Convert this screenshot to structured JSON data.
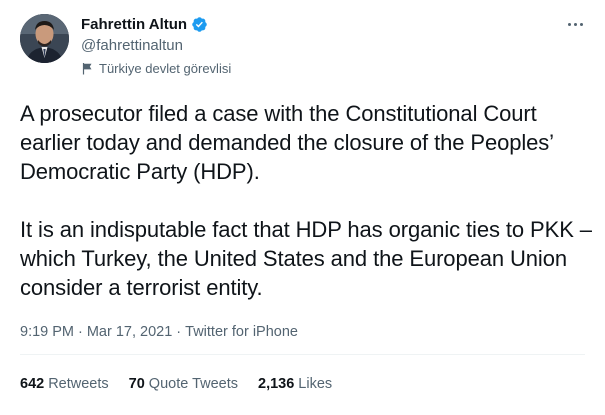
{
  "author": {
    "display_name": "Fahrettin Altun",
    "handle": "@fahrettinaltun",
    "label": "Türkiye devlet görevlisi",
    "verified": true,
    "avatar_icon": "profile-photo"
  },
  "tweet": {
    "paragraphs": [
      "A prosecutor filed a case with the Constitutional Court earlier today and demanded the closure of the Peoples’ Democratic Party (HDP).",
      "It is an indisputable fact that HDP has organic ties to PKK –which Turkey, the United States and the European Union consider a terrorist entity."
    ]
  },
  "meta": {
    "time": "9:19 PM",
    "sep1": "·",
    "date": "Mar 17, 2021",
    "sep2": "·",
    "source": "Twitter for iPhone"
  },
  "stats": {
    "retweets": {
      "count": "642",
      "label": "Retweets"
    },
    "quotes": {
      "count": "70",
      "label": "Quote Tweets"
    },
    "likes": {
      "count": "2,136",
      "label": "Likes"
    }
  },
  "colors": {
    "verified_blue": "#1d9bf0",
    "text_primary": "#0f1419",
    "text_secondary": "#536471",
    "divider": "#eff3f4"
  }
}
